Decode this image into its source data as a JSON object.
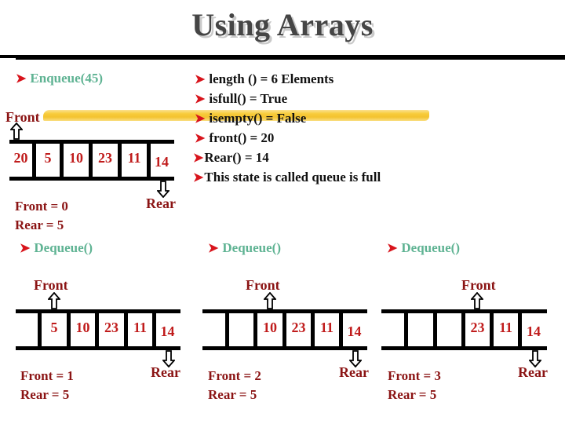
{
  "title": "Using Arrays",
  "enqueue": {
    "label": "Enqueue(45)",
    "front_label": "Front",
    "rear_label": "Rear",
    "cells": [
      "20",
      "5",
      "10",
      "23",
      "11",
      "14"
    ],
    "front_state": "Front = 0",
    "rear_state": "Rear = 5"
  },
  "properties": [
    {
      "text": "length () = 6 Elements"
    },
    {
      "text": "isfull() = True"
    },
    {
      "text": "isempty() = False"
    },
    {
      "text": "front() = 20"
    },
    {
      "text": "Rear() = 14"
    },
    {
      "text": "This state is called queue is full"
    }
  ],
  "dequeues": [
    {
      "label": "Dequeue()",
      "front_label": "Front",
      "rear_label": "Rear",
      "cells": [
        "",
        "5",
        "10",
        "23",
        "11",
        "14"
      ],
      "front_state": "Front = 1",
      "rear_state": "Rear = 5"
    },
    {
      "label": "Dequeue()",
      "front_label": "Front",
      "rear_label": "Rear",
      "cells": [
        "",
        "",
        "10",
        "23",
        "11",
        "14"
      ],
      "front_state": "Front = 2",
      "rear_state": "Rear = 5"
    },
    {
      "label": "Dequeue()",
      "front_label": "Front",
      "rear_label": "Rear",
      "cells": [
        "",
        "",
        "",
        "23",
        "11",
        "14"
      ],
      "front_state": "Front = 3",
      "rear_state": "Rear = 5"
    }
  ],
  "colors": {
    "title": "#454545",
    "operation": "#5fb393",
    "bullet_arrow": "#d8141c",
    "pointer_label": "#8b1414",
    "cell_value": "#c01c1c",
    "highlight": "#f7c930"
  }
}
